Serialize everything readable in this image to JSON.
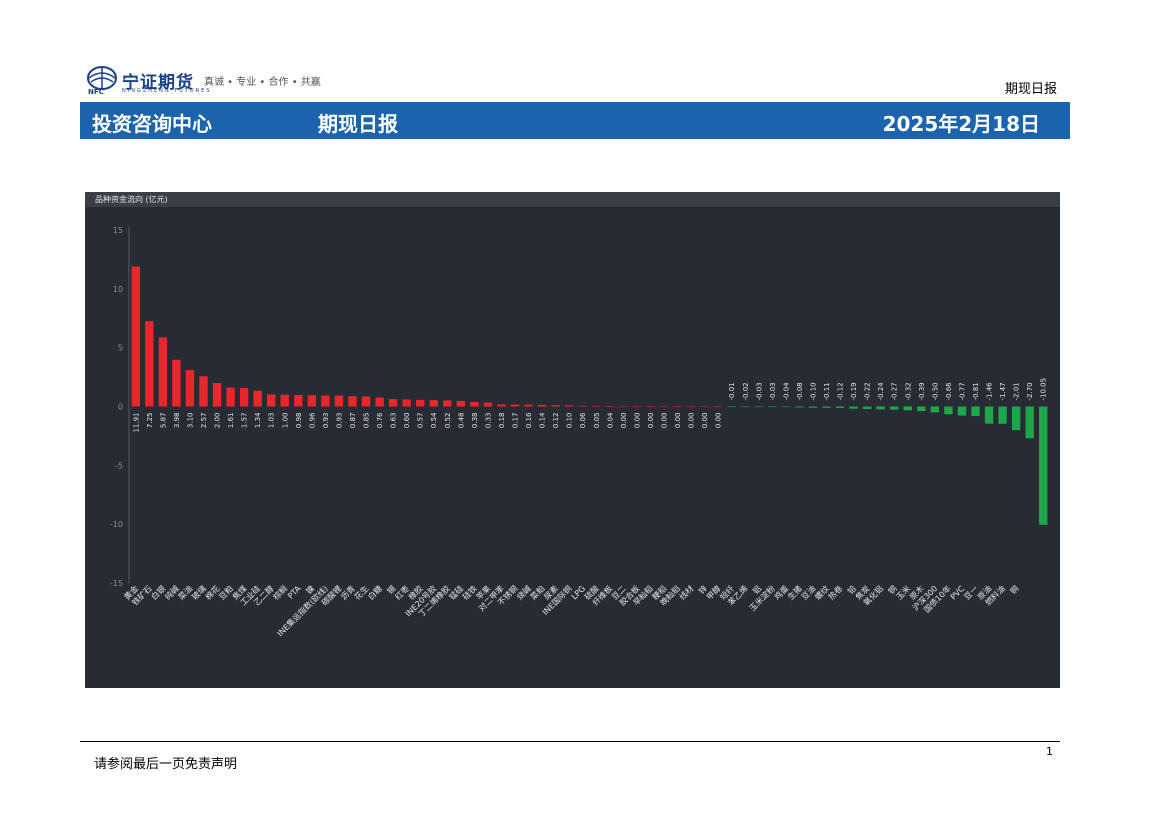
{
  "header": {
    "logo_cn": "宁证期货",
    "logo_slogan": "真诚 • 专业 • 合作 • 共赢",
    "logo_en": "NINGZHENG FUTURES",
    "logo_abbr": "NFC",
    "doc_type": "期现日报",
    "banner_left": "投资咨询中心",
    "banner_mid": "期现日报",
    "banner_date": "2025年2月18日",
    "banner_color": "#1b64ad"
  },
  "footer": {
    "disclaimer": "请参阅最后一页免责声明",
    "page_number": "1"
  },
  "colors": {
    "positive": "#e8262b",
    "negative": "#1ea64a",
    "background": "#272b33"
  },
  "chart_data": {
    "type": "bar",
    "title": "品种资金流向 (亿元)",
    "ylim": [
      -15,
      15
    ],
    "yticks": [
      15,
      10,
      5,
      0,
      -5,
      -10,
      -15
    ],
    "grid": false,
    "categories": [
      "黄金",
      "铁矿石",
      "白银",
      "纯碱",
      "菜油",
      "玻璃",
      "棉花",
      "豆粕",
      "焦煤",
      "工业硅",
      "乙二醇",
      "棕榈",
      "PTA",
      "镍",
      "INE集运指数(欧线)",
      "碳酸锂",
      "沥青",
      "花生",
      "白糖",
      "锡",
      "红枣",
      "橡胶",
      "INE20号胶",
      "丁二烯橡胶",
      "锰硅",
      "硅铁",
      "苹果",
      "对二甲苯",
      "不锈钢",
      "烧碱",
      "菜粕",
      "尿素",
      "INE国际铜",
      "LPG",
      "硫酸",
      "纤维板",
      "豆二",
      "胶合板",
      "早籼稻",
      "粳稻",
      "晚籼稻",
      "线材",
      "锌",
      "甲醇",
      "短纤",
      "苯乙烯",
      "铝",
      "玉米淀粉",
      "鸡蛋",
      "生猪",
      "豆油",
      "螺纹",
      "热卷",
      "铅",
      "焦炭",
      "氧化铝",
      "铜",
      "玉米",
      "原木",
      "沪深300",
      "国债10年",
      "PVC",
      "豆一",
      "原油",
      "燃料油",
      "铜"
    ],
    "values": [
      11.91,
      7.25,
      5.87,
      3.98,
      3.1,
      2.57,
      2.0,
      1.61,
      1.57,
      1.34,
      1.03,
      1.0,
      0.98,
      0.96,
      0.93,
      0.93,
      0.87,
      0.85,
      0.76,
      0.63,
      0.6,
      0.57,
      0.54,
      0.52,
      0.48,
      0.38,
      0.33,
      0.18,
      0.17,
      0.16,
      0.14,
      0.12,
      0.1,
      0.06,
      0.05,
      0.04,
      0.0,
      0.0,
      0.0,
      0.0,
      0.0,
      0.0,
      0.0,
      0.0,
      -0.01,
      -0.02,
      -0.03,
      -0.03,
      -0.04,
      -0.08,
      -0.1,
      -0.11,
      -0.12,
      -0.19,
      -0.22,
      -0.24,
      -0.27,
      -0.32,
      -0.39,
      -0.5,
      -0.66,
      -0.77,
      -0.81,
      -1.46,
      -1.47,
      -2.01,
      -2.7,
      -10.05
    ]
  }
}
